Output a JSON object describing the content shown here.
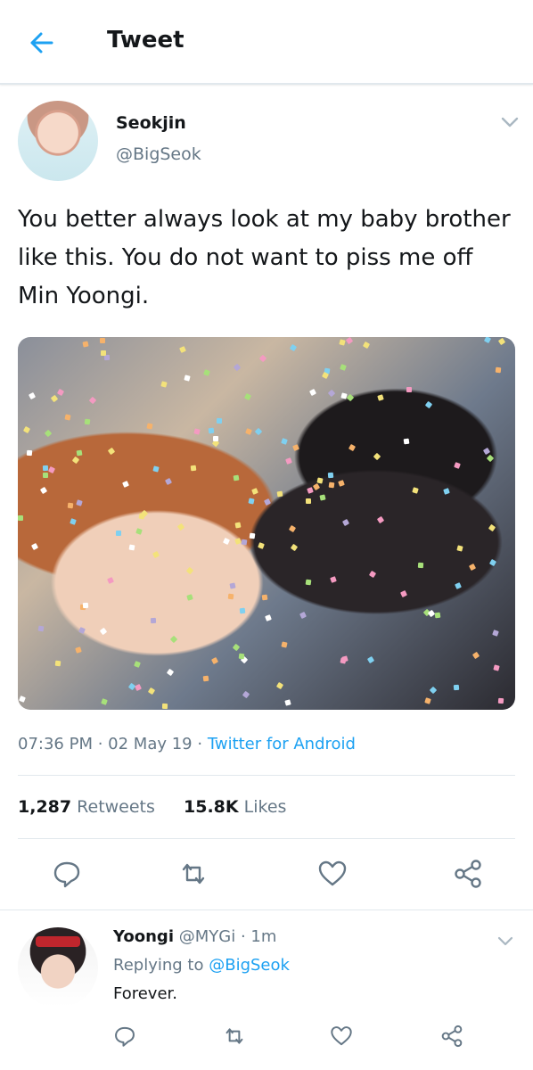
{
  "header": {
    "title": "Tweet"
  },
  "tweet": {
    "author_name": "Seokjin",
    "author_handle": "@BigSeok",
    "text": "You better always look at my baby brother like this. You do not want to piss me off Min Yoongi.",
    "time": "07:36 PM",
    "date": "02 May 19",
    "source": "Twitter for Android",
    "retweets_count": "1,287",
    "retweets_label": "Retweets",
    "likes_count": "15.8K",
    "likes_label": "Likes"
  },
  "reply": {
    "name": "Yoongi",
    "handle": "@MYGi",
    "age": "1m",
    "replying_label": "Replying to",
    "replying_to": "@BigSeok",
    "text": "Forever."
  },
  "icons": {
    "back": "arrow-left-icon",
    "caret": "chevron-down-icon",
    "reply": "comment-icon",
    "retweet": "retweet-icon",
    "like": "heart-icon",
    "share": "share-icon"
  },
  "colors": {
    "accent": "#1da1f2",
    "text": "#14171a",
    "muted": "#657786",
    "divider": "#e1e8ed"
  }
}
